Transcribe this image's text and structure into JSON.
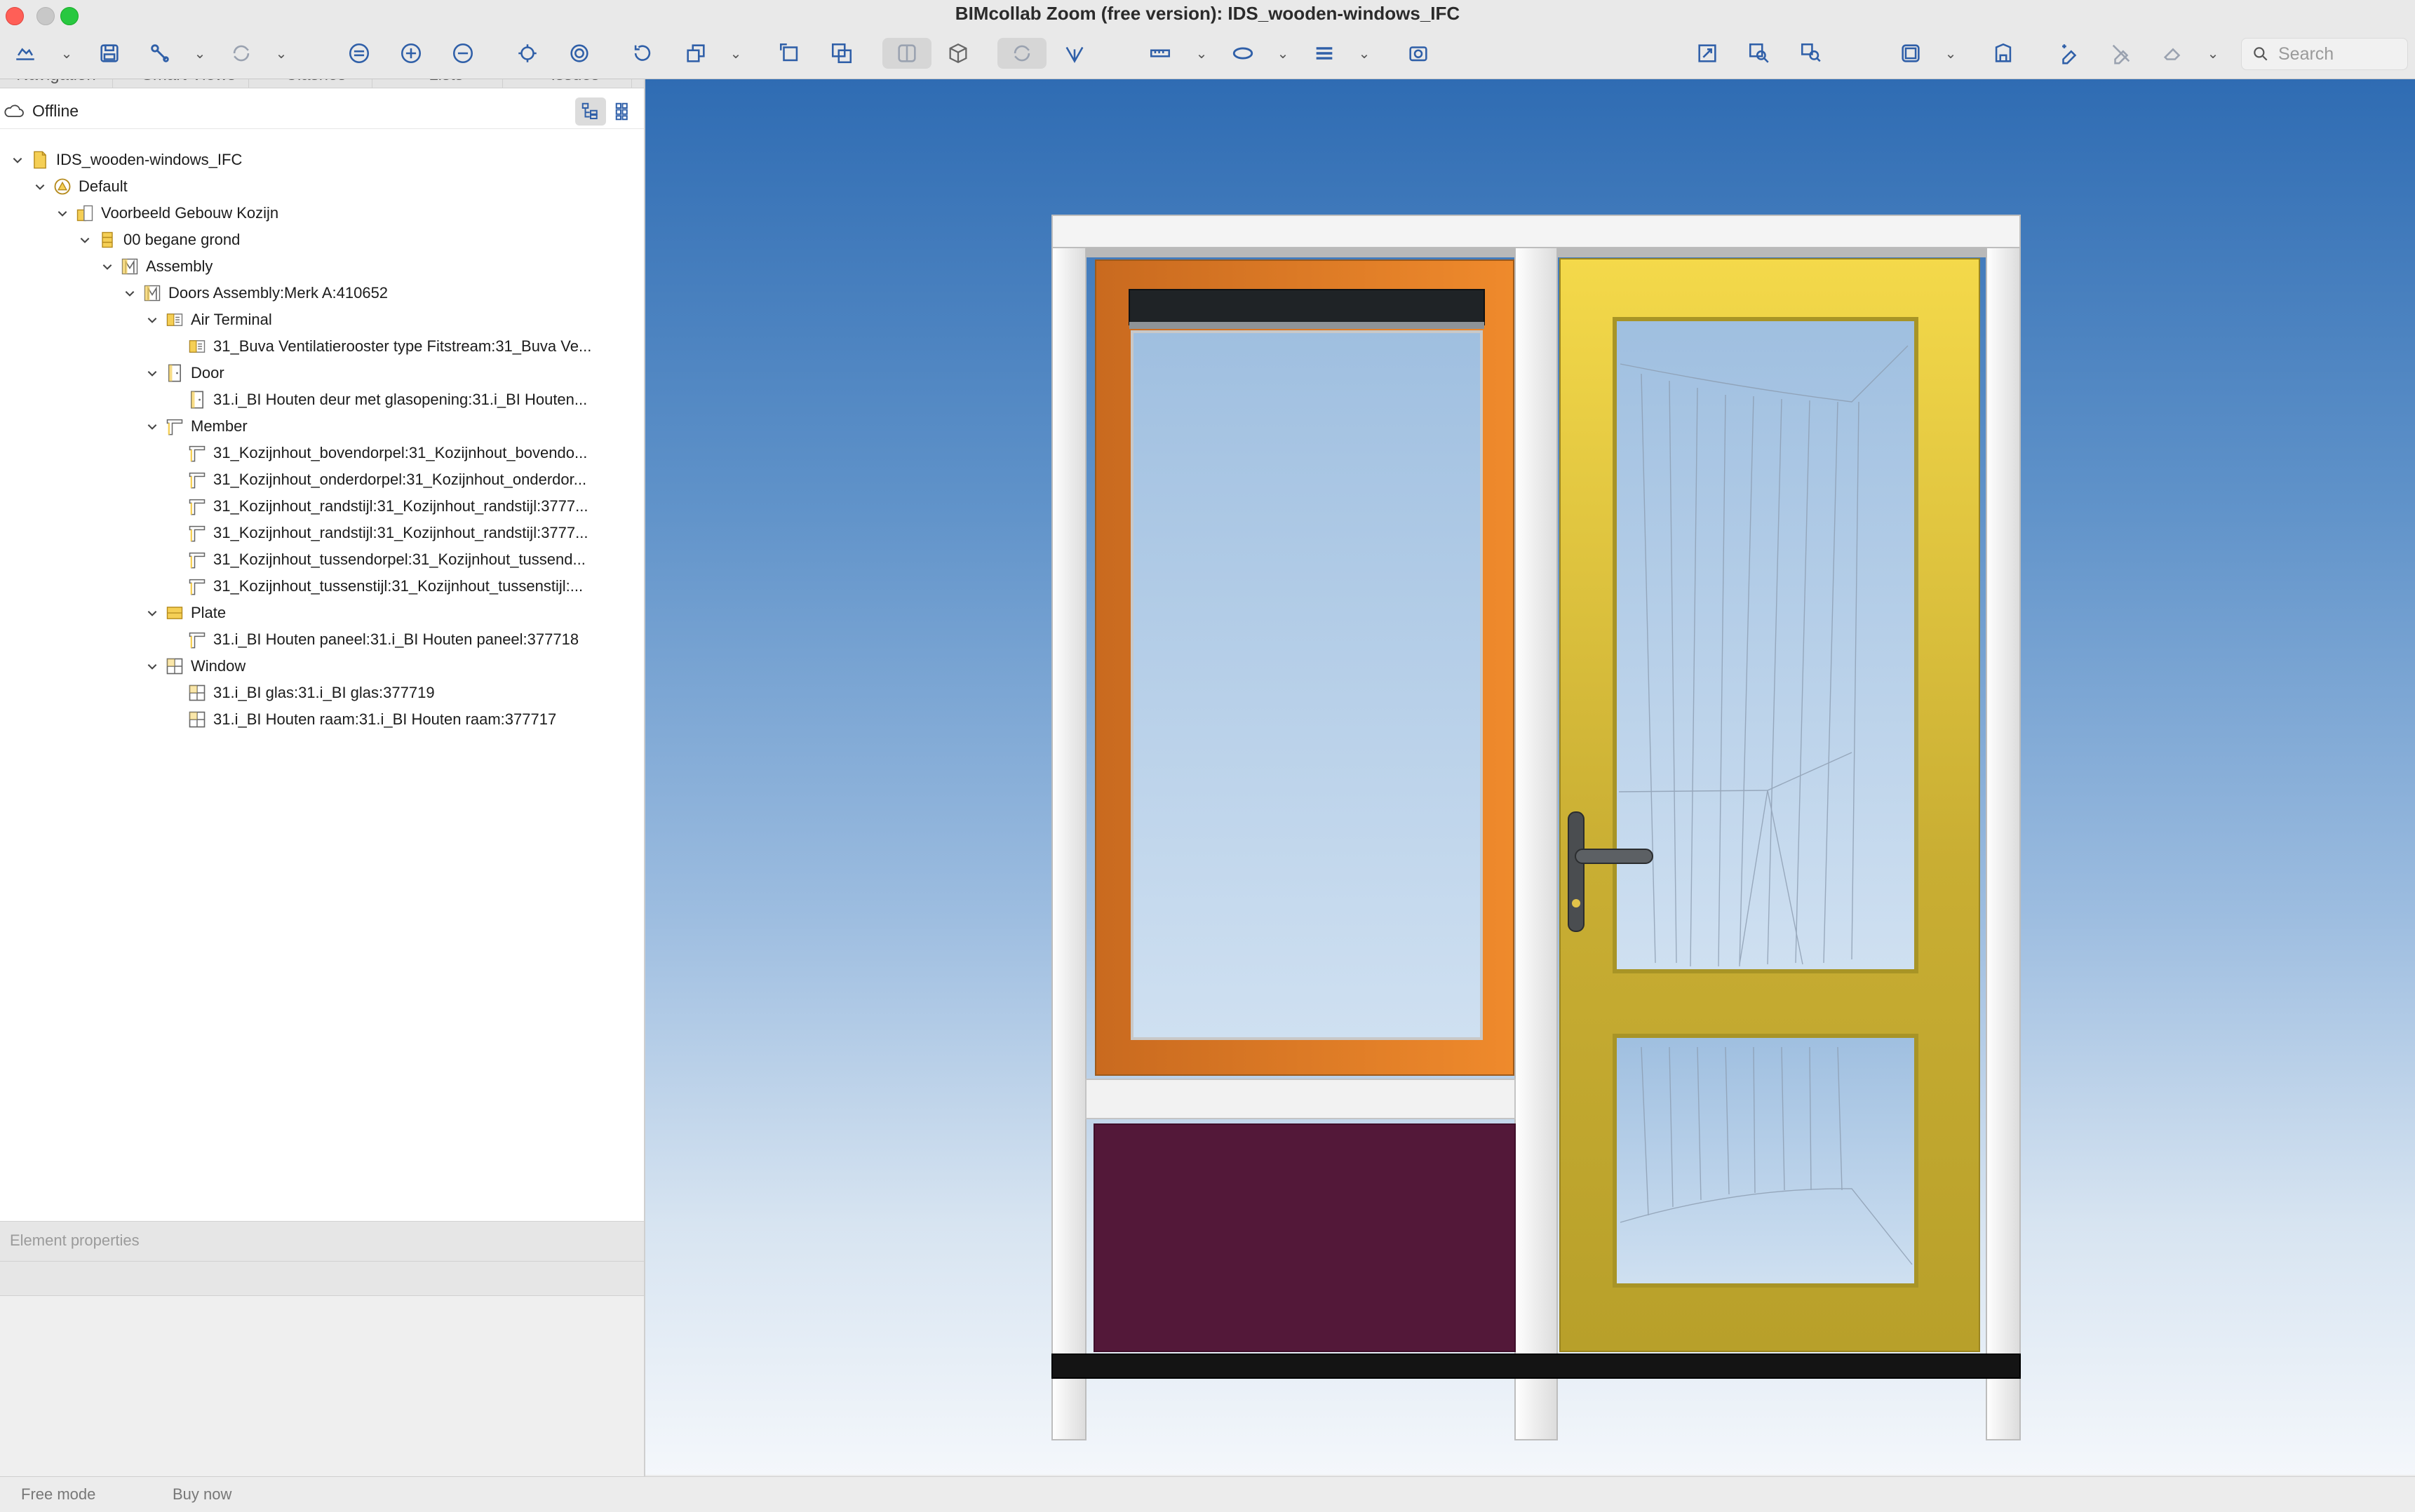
{
  "window": {
    "title": "BIMcollab Zoom (free version): IDS_wooden-windows_IFC"
  },
  "toolbar": {
    "search_placeholder": "Search",
    "icons": [
      "open-icon",
      "save-icon",
      "clash-icon",
      "sync-icon",
      "hide-icon",
      "zoom-in-icon",
      "zoom-out-icon",
      "focus-icon",
      "isolate-icon",
      "rotate-icon",
      "section-icon",
      "select-box-icon",
      "transparency-icon",
      "wireframe-icon",
      "cube-icon",
      "orbit-icon",
      "walk-icon",
      "measure-icon",
      "ellipse-icon",
      "menu-icon",
      "camera-icon",
      "fit-icon",
      "find-icon",
      "smart-find-icon",
      "view-box-icon",
      "storey-icon",
      "markup-icon",
      "erase-markup-icon",
      "clear-icon"
    ]
  },
  "panel": {
    "tabs": [
      "Navigation",
      "Smart Views",
      "Clashes",
      "Lists",
      "Issues"
    ],
    "status": "Offline"
  },
  "tree": [
    {
      "label": "IDS_wooden-windows_IFC",
      "icon": "file-icon",
      "expanded": true,
      "level": 0
    },
    {
      "label": "Default",
      "icon": "site-icon",
      "expanded": true,
      "level": 1
    },
    {
      "label": "Voorbeeld Gebouw Kozijn",
      "icon": "building-icon",
      "expanded": true,
      "level": 2
    },
    {
      "label": "00 begane grond",
      "icon": "storey-icon",
      "expanded": true,
      "level": 3
    },
    {
      "label": "Assembly",
      "icon": "assembly-icon",
      "expanded": true,
      "level": 4
    },
    {
      "label": "Doors Assembly:Merk A:410652",
      "icon": "assembly-icon",
      "expanded": true,
      "level": 5
    },
    {
      "label": "Air Terminal",
      "icon": "air-terminal-icon",
      "expanded": true,
      "level": 6
    },
    {
      "label": "31_Buva Ventilatierooster type Fitstream:31_Buva Ve...",
      "icon": "air-terminal-icon",
      "expanded": null,
      "level": 7
    },
    {
      "label": "Door",
      "icon": "door-icon",
      "expanded": true,
      "level": 6
    },
    {
      "label": "31.i_BI Houten deur met glasopening:31.i_BI Houten...",
      "icon": "door-icon",
      "expanded": null,
      "level": 7
    },
    {
      "label": "Member",
      "icon": "member-icon",
      "expanded": true,
      "level": 6
    },
    {
      "label": "31_Kozijnhout_bovendorpel:31_Kozijnhout_bovendo...",
      "icon": "member-icon",
      "expanded": null,
      "level": 7
    },
    {
      "label": "31_Kozijnhout_onderdorpel:31_Kozijnhout_onderdor...",
      "icon": "member-icon",
      "expanded": null,
      "level": 7
    },
    {
      "label": "31_Kozijnhout_randstijl:31_Kozijnhout_randstijl:3777...",
      "icon": "member-icon",
      "expanded": null,
      "level": 7
    },
    {
      "label": "31_Kozijnhout_randstijl:31_Kozijnhout_randstijl:3777...",
      "icon": "member-icon",
      "expanded": null,
      "level": 7
    },
    {
      "label": "31_Kozijnhout_tussendorpel:31_Kozijnhout_tussend...",
      "icon": "member-icon",
      "expanded": null,
      "level": 7
    },
    {
      "label": "31_Kozijnhout_tussenstijl:31_Kozijnhout_tussenstijl:...",
      "icon": "member-icon",
      "expanded": null,
      "level": 7
    },
    {
      "label": "Plate",
      "icon": "plate-icon",
      "expanded": true,
      "level": 6
    },
    {
      "label": "31.i_BI Houten paneel:31.i_BI Houten paneel:377718",
      "icon": "member-icon",
      "expanded": null,
      "level": 7
    },
    {
      "label": "Window",
      "icon": "window-icon",
      "expanded": true,
      "level": 6
    },
    {
      "label": "31.i_BI glas:31.i_BI glas:377719",
      "icon": "window-icon",
      "expanded": null,
      "level": 7
    },
    {
      "label": "31.i_BI Houten raam:31.i_BI Houten raam:377717",
      "icon": "window-icon",
      "expanded": null,
      "level": 7
    }
  ],
  "properties": {
    "title": "Element properties"
  },
  "statusbar": {
    "mode": "Free mode",
    "buy": "Buy now"
  },
  "colors": {
    "accent": "#2f5fa8",
    "sky_top": "#2f6cb3",
    "window_frame_orange": "#e07a25",
    "panel_purple": "#531839",
    "door_yellow": "#d9c43a",
    "frame_white": "#f2f2f2"
  }
}
